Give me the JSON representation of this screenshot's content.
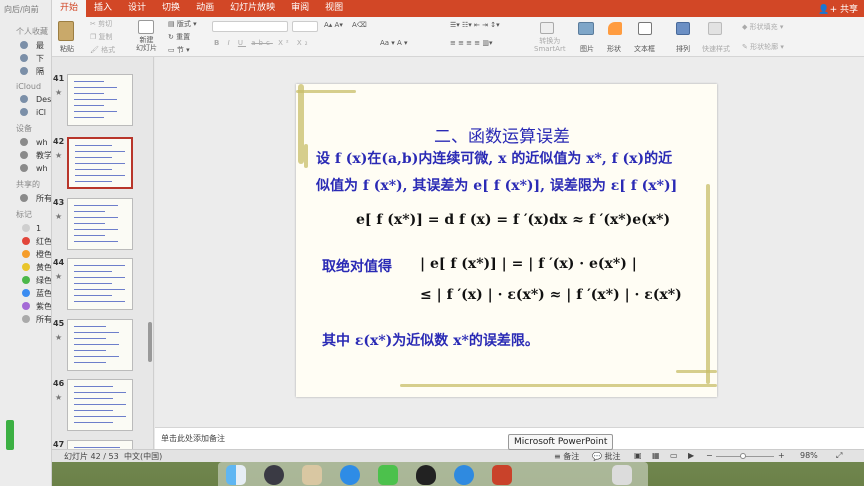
{
  "finder": {
    "header": "向后/向前",
    "favorites_label": "个人收藏",
    "favorites": [
      "最",
      "下",
      "隔"
    ],
    "icloud_label": "iCloud",
    "icloud": [
      "Des",
      "iCl"
    ],
    "devices_label": "设备",
    "devices": [
      "wh",
      "教学",
      "wh"
    ],
    "shared_label": "共享的",
    "shared": [
      "所有"
    ],
    "tags_label": "标记",
    "tags": [
      {
        "label": "1",
        "color": "#cfcfcf"
      },
      {
        "label": "红色",
        "color": "#e2463b"
      },
      {
        "label": "橙色",
        "color": "#f59d2a"
      },
      {
        "label": "黄色",
        "color": "#e9c52b"
      },
      {
        "label": "绿色",
        "color": "#4cb84a"
      },
      {
        "label": "蓝色",
        "color": "#3b8cf1"
      },
      {
        "label": "紫色",
        "color": "#a46ad6"
      },
      {
        "label": "所有",
        "color": "#aaaaaa"
      }
    ]
  },
  "ribbon": {
    "tabs": [
      "开始",
      "插入",
      "设计",
      "切换",
      "动画",
      "幻灯片放映",
      "审阅",
      "视图"
    ],
    "active_tab": "开始",
    "share_label": "共享",
    "paste_label": "粘贴",
    "cut_label": "剪切",
    "copy_label": "复制",
    "format_label": "格式",
    "new_slide_label": "新建\n幻灯片",
    "layout_label": "版式",
    "reset_label": "重置",
    "section_label": "节",
    "convert_smartart_label": "转换为\nSmartArt",
    "picture_label": "图片",
    "shape_label": "形状",
    "textbox_label": "文本框",
    "arrange_label": "排列",
    "quick_styles_label": "快速样式",
    "shape_fill_label": "形状填充",
    "shape_outline_label": "形状轮廓",
    "format_buttons": [
      "B",
      "I",
      "U",
      "abc",
      "X²",
      "X₂"
    ]
  },
  "thumbnails": [
    {
      "number": "41"
    },
    {
      "number": "42",
      "selected": true
    },
    {
      "number": "43"
    },
    {
      "number": "44"
    },
    {
      "number": "45"
    },
    {
      "number": "46"
    },
    {
      "number": "47"
    }
  ],
  "slide": {
    "title": "二、函数运算误差",
    "line1": "设 f (x)在(a,b)内连续可微, x 的近似值为  x*, f (x)的近",
    "line2": "似值为 f (x*), 其误差为 e[ f (x*)], 误差限为 ε[ f (x*)]",
    "formula1": "e[ f (x*)] = d f (x) = f ′(x)dx ≈ f ′(x*)e(x*)",
    "abs_label": "取绝对值得",
    "formula2": "| e[ f (x*)] | = | f ′(x) · e(x*) |",
    "formula3": "≤ | f ′(x) | · ε(x*) ≈ | f ′(x*) | · ε(x*)",
    "conclusion": "其中 ε(x*)为近似数 x*的误差限。"
  },
  "notes_placeholder": "单击此处添加备注",
  "status": {
    "slide_position": "幻灯片 42 / 53",
    "language": "中文(中国)",
    "notes_button": "备注",
    "comments_button": "批注",
    "zoom": "98%"
  },
  "tooltip": "Microsoft PowerPoint"
}
